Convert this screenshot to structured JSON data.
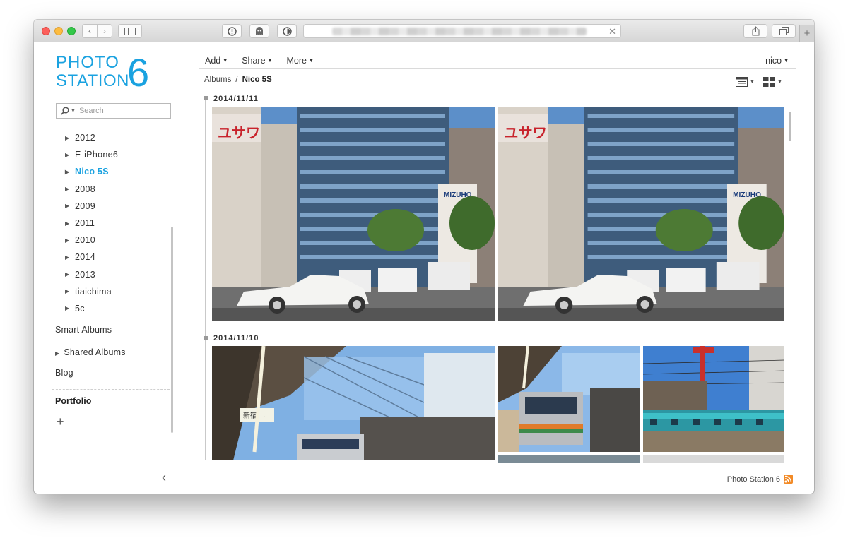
{
  "browser": {
    "nav": {
      "back": "‹",
      "forward": "›"
    },
    "close_url": "✕",
    "new_tab": "+",
    "icons": [
      "sidebar-icon",
      "info-extension-icon",
      "ghost-extension-icon",
      "privacy-extension-icon",
      "share-icon",
      "tabs-icon"
    ]
  },
  "logo": {
    "line1": "PHOTO",
    "line2": "STATION",
    "number": "6"
  },
  "search": {
    "placeholder": "Search"
  },
  "albums": [
    {
      "label": "2012",
      "active": false
    },
    {
      "label": "E-iPhone6",
      "active": false
    },
    {
      "label": "Nico 5S",
      "active": true
    },
    {
      "label": "2008",
      "active": false
    },
    {
      "label": "2009",
      "active": false
    },
    {
      "label": "2011",
      "active": false
    },
    {
      "label": "2010",
      "active": false
    },
    {
      "label": "2014",
      "active": false
    },
    {
      "label": "2013",
      "active": false
    },
    {
      "label": "tiaichima",
      "active": false
    },
    {
      "label": "5c",
      "active": false
    }
  ],
  "sidebar_links": {
    "smart_albums": "Smart Albums",
    "shared_albums": "Shared Albums",
    "blog": "Blog",
    "portfolio": "Portfolio",
    "add": "+",
    "collapse": "‹"
  },
  "menu": {
    "add": "Add",
    "share": "Share",
    "more": "More"
  },
  "user": {
    "name": "nico"
  },
  "breadcrumb": {
    "root": "Albums",
    "separator": "/",
    "current": "Nico 5S"
  },
  "sections": [
    {
      "date": "2014/11/11"
    },
    {
      "date": "2014/11/10"
    }
  ],
  "footer": {
    "label": "Photo Station 6"
  },
  "colors": {
    "accent": "#1aa2e0",
    "rss": "#f28a26"
  }
}
